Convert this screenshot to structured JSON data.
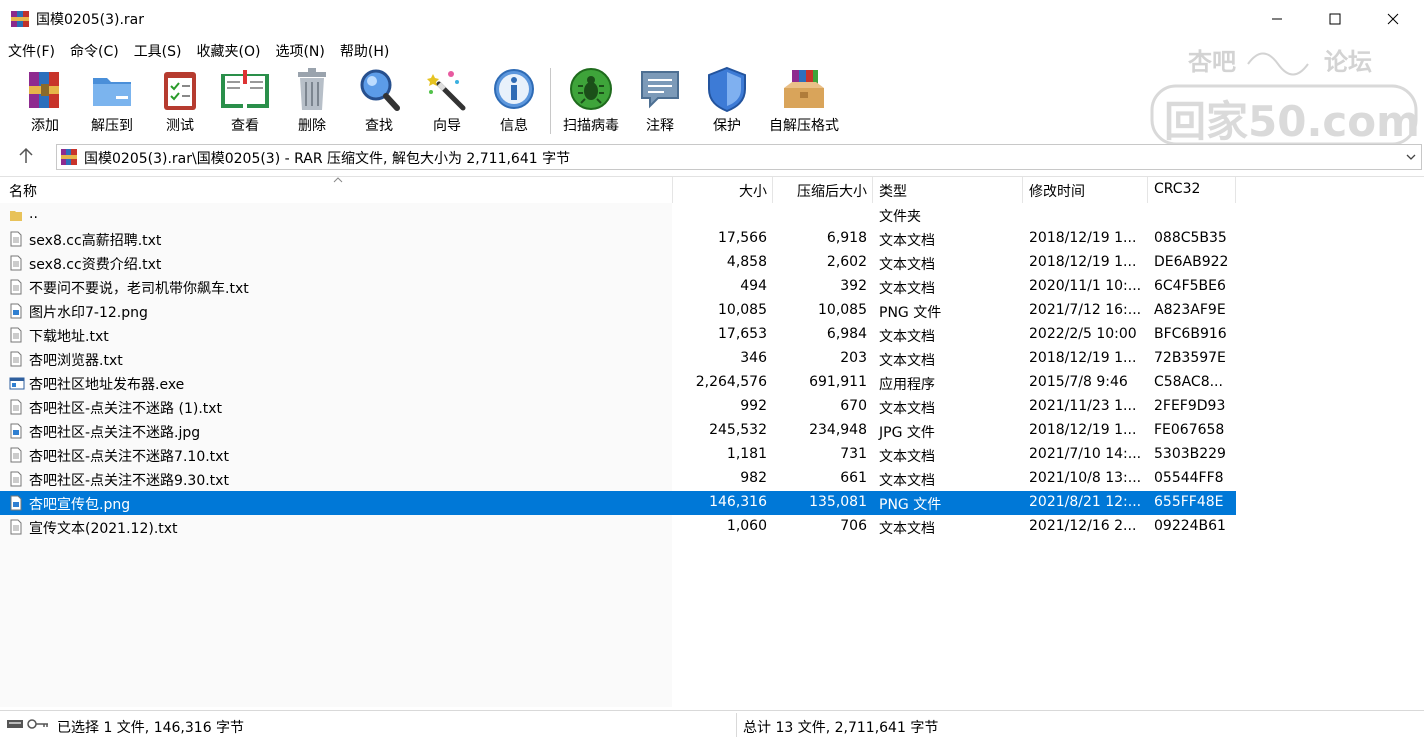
{
  "window": {
    "title": "国模0205(3).rar",
    "minimize_icon": "minimize-icon",
    "maximize_icon": "maximize-icon",
    "close_icon": "close-icon"
  },
  "menu": [
    "文件(F)",
    "命令(C)",
    "工具(S)",
    "收藏夹(O)",
    "选项(N)",
    "帮助(H)"
  ],
  "toolbar": [
    {
      "label": "添加",
      "icon": "add-archive-icon"
    },
    {
      "label": "解压到",
      "icon": "extract-folder-icon"
    },
    {
      "label": "测试",
      "icon": "test-clipboard-icon"
    },
    {
      "label": "查看",
      "icon": "view-book-icon"
    },
    {
      "label": "删除",
      "icon": "trash-icon"
    },
    {
      "label": "查找",
      "icon": "magnifier-icon"
    },
    {
      "label": "向导",
      "icon": "wizard-wand-icon"
    },
    {
      "label": "信息",
      "icon": "info-icon"
    },
    {
      "label": "扫描病毒",
      "icon": "virus-scan-icon"
    },
    {
      "label": "注释",
      "icon": "comment-icon"
    },
    {
      "label": "保护",
      "icon": "shield-icon"
    },
    {
      "label": "自解压格式",
      "icon": "sfx-box-icon"
    }
  ],
  "watermark": {
    "line1": "杏吧",
    "line2": "论坛",
    "line3": "回家50.com"
  },
  "address": {
    "text": "国模0205(3).rar\\国模0205(3) - RAR 压缩文件, 解包大小为 2,711,641 字节"
  },
  "columns": {
    "name": "名称",
    "size": "大小",
    "packed": "压缩后大小",
    "type": "类型",
    "modified": "修改时间",
    "crc": "CRC32"
  },
  "files": [
    {
      "name": "..",
      "size": "",
      "packed": "",
      "type": "文件夹",
      "modified": "",
      "crc": "",
      "icon": "folder"
    },
    {
      "name": "sex8.cc高薪招聘.txt",
      "size": "17,566",
      "packed": "6,918",
      "type": "文本文档",
      "modified": "2018/12/19 1...",
      "crc": "088C5B35",
      "icon": "txt"
    },
    {
      "name": "sex8.cc资费介绍.txt",
      "size": "4,858",
      "packed": "2,602",
      "type": "文本文档",
      "modified": "2018/12/19 1...",
      "crc": "DE6AB922",
      "icon": "txt"
    },
    {
      "name": "不要问不要说，老司机带你飙车.txt",
      "size": "494",
      "packed": "392",
      "type": "文本文档",
      "modified": "2020/11/1 10:...",
      "crc": "6C4F5BE6",
      "icon": "txt"
    },
    {
      "name": "图片水印7-12.png",
      "size": "10,085",
      "packed": "10,085",
      "type": "PNG 文件",
      "modified": "2021/7/12 16:...",
      "crc": "A823AF9E",
      "icon": "img"
    },
    {
      "name": "下载地址.txt",
      "size": "17,653",
      "packed": "6,984",
      "type": "文本文档",
      "modified": "2022/2/5 10:00",
      "crc": "BFC6B916",
      "icon": "txt"
    },
    {
      "name": "杏吧浏览器.txt",
      "size": "346",
      "packed": "203",
      "type": "文本文档",
      "modified": "2018/12/19 1...",
      "crc": "72B3597E",
      "icon": "txt"
    },
    {
      "name": "杏吧社区地址发布器.exe",
      "size": "2,264,576",
      "packed": "691,911",
      "type": "应用程序",
      "modified": "2015/7/8 9:46",
      "crc": "C58AC8...",
      "icon": "exe"
    },
    {
      "name": "杏吧社区-点关注不迷路 (1).txt",
      "size": "992",
      "packed": "670",
      "type": "文本文档",
      "modified": "2021/11/23 1...",
      "crc": "2FEF9D93",
      "icon": "txt"
    },
    {
      "name": "杏吧社区-点关注不迷路.jpg",
      "size": "245,532",
      "packed": "234,948",
      "type": "JPG 文件",
      "modified": "2018/12/19 1...",
      "crc": "FE067658",
      "icon": "img"
    },
    {
      "name": "杏吧社区-点关注不迷路7.10.txt",
      "size": "1,181",
      "packed": "731",
      "type": "文本文档",
      "modified": "2021/7/10 14:...",
      "crc": "5303B229",
      "icon": "txt"
    },
    {
      "name": "杏吧社区-点关注不迷路9.30.txt",
      "size": "982",
      "packed": "661",
      "type": "文本文档",
      "modified": "2021/10/8 13:...",
      "crc": "05544FF8",
      "icon": "txt"
    },
    {
      "name": "杏吧宣传包.png",
      "size": "146,316",
      "packed": "135,081",
      "type": "PNG 文件",
      "modified": "2021/8/21 12:...",
      "crc": "655FF48E",
      "icon": "img",
      "selected": true
    },
    {
      "name": "宣传文本(2021.12).txt",
      "size": "1,060",
      "packed": "706",
      "type": "文本文档",
      "modified": "2021/12/16 2...",
      "crc": "09224B61",
      "icon": "txt"
    }
  ],
  "status": {
    "left": "已选择 1 文件, 146,316 字节",
    "right": "总计 13 文件, 2,711,641 字节"
  },
  "colors": {
    "selection": "#0078d7",
    "accent_blue": "#2f7fd1"
  }
}
